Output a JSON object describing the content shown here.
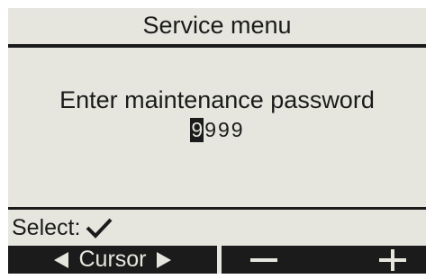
{
  "menu": {
    "title": "Service menu"
  },
  "prompt": {
    "text": "Enter maintenance password"
  },
  "password": {
    "digits": [
      "9",
      "9",
      "9",
      "9"
    ],
    "active_index": 0
  },
  "footer": {
    "select_label": "Select:",
    "select_icon": "check-icon"
  },
  "softkeys": {
    "cursor_label": "Cursor",
    "cursor_left_icon": "triangle-left-icon",
    "cursor_right_icon": "triangle-right-icon",
    "minus_icon": "minus-icon",
    "plus_icon": "plus-icon"
  },
  "colors": {
    "lcd_background": "#e6e6df",
    "foreground": "#1b1b1b"
  }
}
